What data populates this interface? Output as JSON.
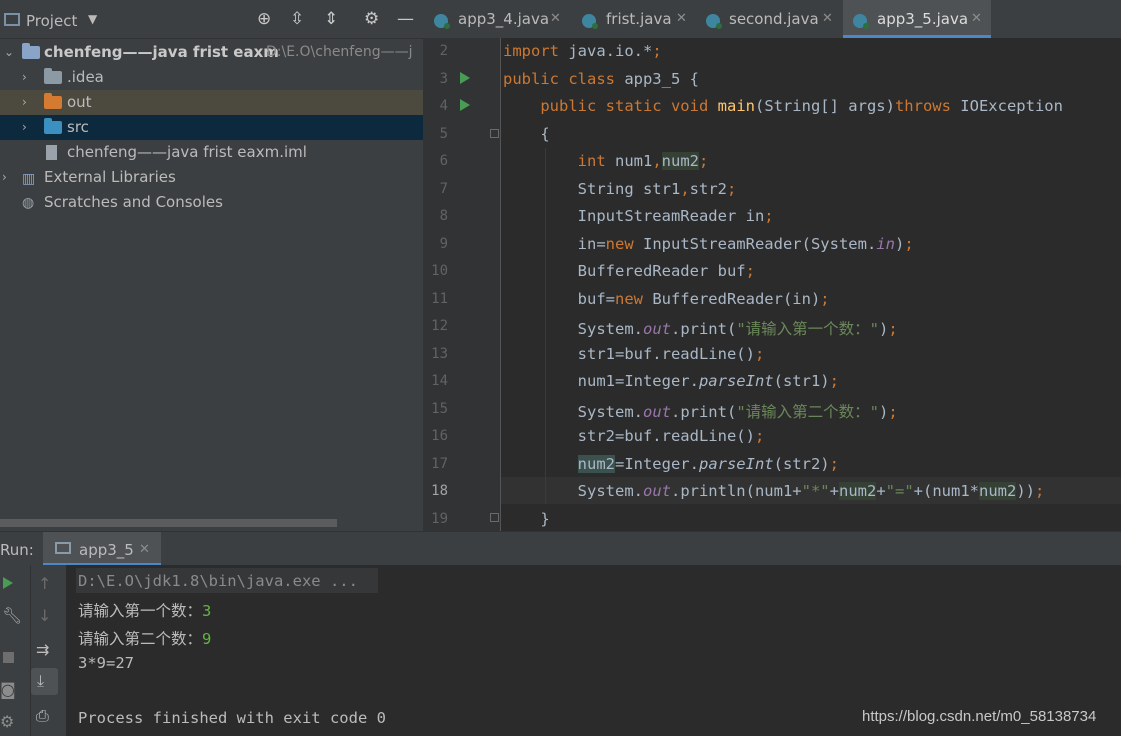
{
  "project_panel": {
    "title": "Project",
    "tree": [
      {
        "label": "chenfeng——java frist eaxm",
        "path": "D:\\E.O\\chenfeng——j"
      },
      {
        "label": ".idea"
      },
      {
        "label": "out"
      },
      {
        "label": "src"
      },
      {
        "label": "chenfeng——java frist eaxm.iml"
      },
      {
        "label": "External Libraries"
      },
      {
        "label": "Scratches and Consoles"
      }
    ]
  },
  "tabs": [
    {
      "label": "app3_4.java"
    },
    {
      "label": "frist.java"
    },
    {
      "label": "second.java"
    },
    {
      "label": "app3_5.java"
    }
  ],
  "editor": {
    "line_numbers": [
      "2",
      "3",
      "4",
      "5",
      "6",
      "7",
      "8",
      "9",
      "10",
      "11",
      "12",
      "13",
      "14",
      "15",
      "16",
      "17",
      "18",
      "19"
    ],
    "lines": [
      [
        {
          "t": "import",
          "c": "kw"
        },
        {
          "t": " java.io.*"
        },
        {
          "t": ";",
          "c": "kw"
        }
      ],
      [
        {
          "t": "public class",
          "c": "kw"
        },
        {
          "t": " app3_5 {"
        }
      ],
      [
        {
          "t": "    "
        },
        {
          "t": "public static void",
          "c": "kw"
        },
        {
          "t": " "
        },
        {
          "t": "main",
          "c": "fn"
        },
        {
          "t": "(String[] args)"
        },
        {
          "t": "throws",
          "c": "kw"
        },
        {
          "t": " IOException"
        }
      ],
      [
        {
          "t": "    {"
        }
      ],
      [
        {
          "t": "        "
        },
        {
          "t": "int",
          "c": "kw"
        },
        {
          "t": " num1"
        },
        {
          "t": ",",
          "c": "kw"
        },
        {
          "t": "num2",
          "c": "var2"
        },
        {
          "t": ";",
          "c": "kw"
        }
      ],
      [
        {
          "t": "        String str1"
        },
        {
          "t": ",",
          "c": "kw"
        },
        {
          "t": "str2"
        },
        {
          "t": ";",
          "c": "kw"
        }
      ],
      [
        {
          "t": "        InputStreamReader in"
        },
        {
          "t": ";",
          "c": "kw"
        }
      ],
      [
        {
          "t": "        in="
        },
        {
          "t": "new",
          "c": "kw"
        },
        {
          "t": " InputStreamReader(System."
        },
        {
          "t": "in",
          "c": "fld"
        },
        {
          "t": ")"
        },
        {
          "t": ";",
          "c": "kw"
        }
      ],
      [
        {
          "t": "        BufferedReader buf"
        },
        {
          "t": ";",
          "c": "kw"
        }
      ],
      [
        {
          "t": "        buf="
        },
        {
          "t": "new",
          "c": "kw"
        },
        {
          "t": " BufferedReader(in)"
        },
        {
          "t": ";",
          "c": "kw"
        }
      ],
      [
        {
          "t": "        System."
        },
        {
          "t": "out",
          "c": "fld"
        },
        {
          "t": ".print("
        },
        {
          "t": "\"请输入第一个数：\"",
          "c": "st"
        },
        {
          "t": ")"
        },
        {
          "t": ";",
          "c": "kw"
        }
      ],
      [
        {
          "t": "        str1=buf.readLine()"
        },
        {
          "t": ";",
          "c": "kw"
        }
      ],
      [
        {
          "t": "        num1=Integer."
        },
        {
          "t": "parseInt",
          "c": "it"
        },
        {
          "t": "(str1)"
        },
        {
          "t": ";",
          "c": "kw"
        }
      ],
      [
        {
          "t": "        System."
        },
        {
          "t": "out",
          "c": "fld"
        },
        {
          "t": ".print("
        },
        {
          "t": "\"请输入第二个数：\"",
          "c": "st"
        },
        {
          "t": ")"
        },
        {
          "t": ";",
          "c": "kw"
        }
      ],
      [
        {
          "t": "        str2=buf.readLine()"
        },
        {
          "t": ";",
          "c": "kw"
        }
      ],
      [
        {
          "t": "        "
        },
        {
          "t": "num2",
          "c": "var2b"
        },
        {
          "t": "=Integer."
        },
        {
          "t": "parseInt",
          "c": "it"
        },
        {
          "t": "(str2)"
        },
        {
          "t": ";",
          "c": "kw"
        }
      ],
      [
        {
          "t": "        System."
        },
        {
          "t": "out",
          "c": "fld"
        },
        {
          "t": ".println(num1+"
        },
        {
          "t": "\"*\"",
          "c": "st"
        },
        {
          "t": "+"
        },
        {
          "t": "num2",
          "c": "var2"
        },
        {
          "t": "+"
        },
        {
          "t": "\"=\"",
          "c": "st"
        },
        {
          "t": "+(num1*"
        },
        {
          "t": "num2",
          "c": "var2"
        },
        {
          "t": "))"
        },
        {
          "t": ";",
          "c": "kw"
        }
      ],
      [
        {
          "t": "    }"
        }
      ]
    ]
  },
  "run_panel": {
    "label": "Run:",
    "tab": "app3_5",
    "console": {
      "command": "D:\\E.O\\jdk1.8\\bin\\java.exe ...",
      "prompt1": "请输入第一个数：",
      "input1": "3",
      "prompt2": "请输入第二个数：",
      "input2": "9",
      "result": "3*9=27",
      "exit": "Process finished with exit code 0"
    }
  },
  "watermark": "https://blog.csdn.net/m0_58138734"
}
